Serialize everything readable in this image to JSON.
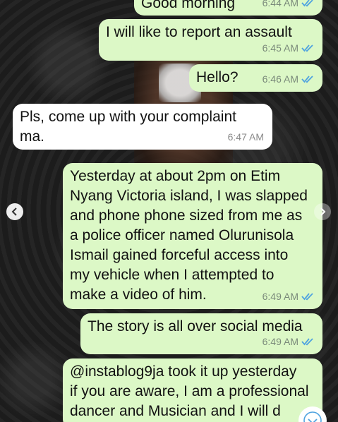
{
  "colors": {
    "outgoing_bubble": "#dcf8c6",
    "incoming_bubble": "#ffffff",
    "read_tick": "#4fa3e0"
  },
  "messages": [
    {
      "direction": "outgoing",
      "text": "Good morning",
      "time": "6:44 AM",
      "status": "read"
    },
    {
      "direction": "outgoing",
      "text": "I will like to report an assault",
      "time": "6:45 AM",
      "status": "read"
    },
    {
      "direction": "outgoing",
      "text": "Hello?",
      "time": "6:46 AM",
      "status": "read"
    },
    {
      "direction": "incoming",
      "lines": [
        "Pls, come up with your complaint",
        "ma."
      ],
      "time": "6:47 AM"
    },
    {
      "direction": "outgoing",
      "lines": [
        "Yesterday at about 2pm on Etim",
        "Nyang Victoria island, I was slapped",
        "and phone phone sized from me as",
        "a police officer named Olurunisola",
        "Ismail gained forceful access into",
        "my vehicle when I attempted to",
        "make a video of him."
      ],
      "time": "6:49 AM",
      "status": "read"
    },
    {
      "direction": "outgoing",
      "text": "The story is all over social media",
      "time": "6:49 AM",
      "status": "read"
    },
    {
      "direction": "outgoing",
      "lines": [
        "@instablog9ja took it up yesterday",
        "if you are aware, I am a professional",
        "dancer and Musician and I will d"
      ]
    }
  ],
  "icons": {
    "prev": "chevron-left-icon",
    "next": "chevron-right-icon",
    "scroll_down": "chevron-down-icon",
    "read_receipt": "double-check-icon"
  }
}
